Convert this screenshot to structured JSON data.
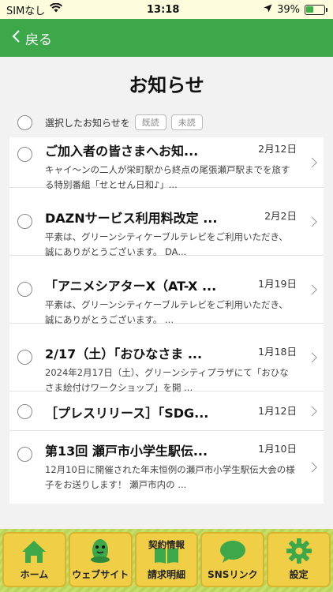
{
  "status": {
    "carrier": "SIMなし",
    "time": "13:18",
    "battery": "39%",
    "battery_level": 0.39
  },
  "nav": {
    "back_label": "戻る"
  },
  "page": {
    "title": "お知らせ"
  },
  "select": {
    "label": "選択したお知らせを",
    "read_label": "既読",
    "unread_label": "未読"
  },
  "items": [
    {
      "title": "ご加入者の皆さまへお知...",
      "date": "2月12日",
      "desc": "キャイ〜ンの二人が栄町駅から終点の尾張瀬戸駅までを旅する特別番組「せとせん日和♪」..."
    },
    {
      "title": "DAZNサービス利用料改定 ...",
      "date": "2月2日",
      "desc": "平素は、グリーンシティケーブルテレビをご利用いただき、誠にありがとうございます。 DA..."
    },
    {
      "title": "「アニメシアターX（AT-X ...",
      "date": "1月19日",
      "desc": "平素は、グリーンシティケーブルテレビをご利用いただき、誠にありがとうございます。 ..."
    },
    {
      "title": "2/17（土）「おひなさま ...",
      "date": "1月18日",
      "desc": "2024年2月17日（土）、グリーンシティプラザにて「おひなさま絵付けワークショップ」を開 ..."
    },
    {
      "title": "［プレスリリース］「SDG...",
      "date": "1月12日",
      "desc": ""
    },
    {
      "title": "第13回 瀬戸市小学生駅伝...",
      "date": "1月10日",
      "desc": "12月10日に開催された年末恒例の瀬戸市小学生駅伝大会の様子をお送りします！ 瀬戸市内の ..."
    }
  ],
  "tabs": {
    "home": "ホーム",
    "website": "ウェブサイト",
    "contract_top": "契約情報",
    "contract_bottom": "請求明細",
    "sns": "SNSリンク",
    "settings": "設定"
  },
  "colors": {
    "nav_green": "#3ca84a",
    "tab_yellow": "#f0cf47",
    "tab_icon_green": "#3ca84a"
  }
}
